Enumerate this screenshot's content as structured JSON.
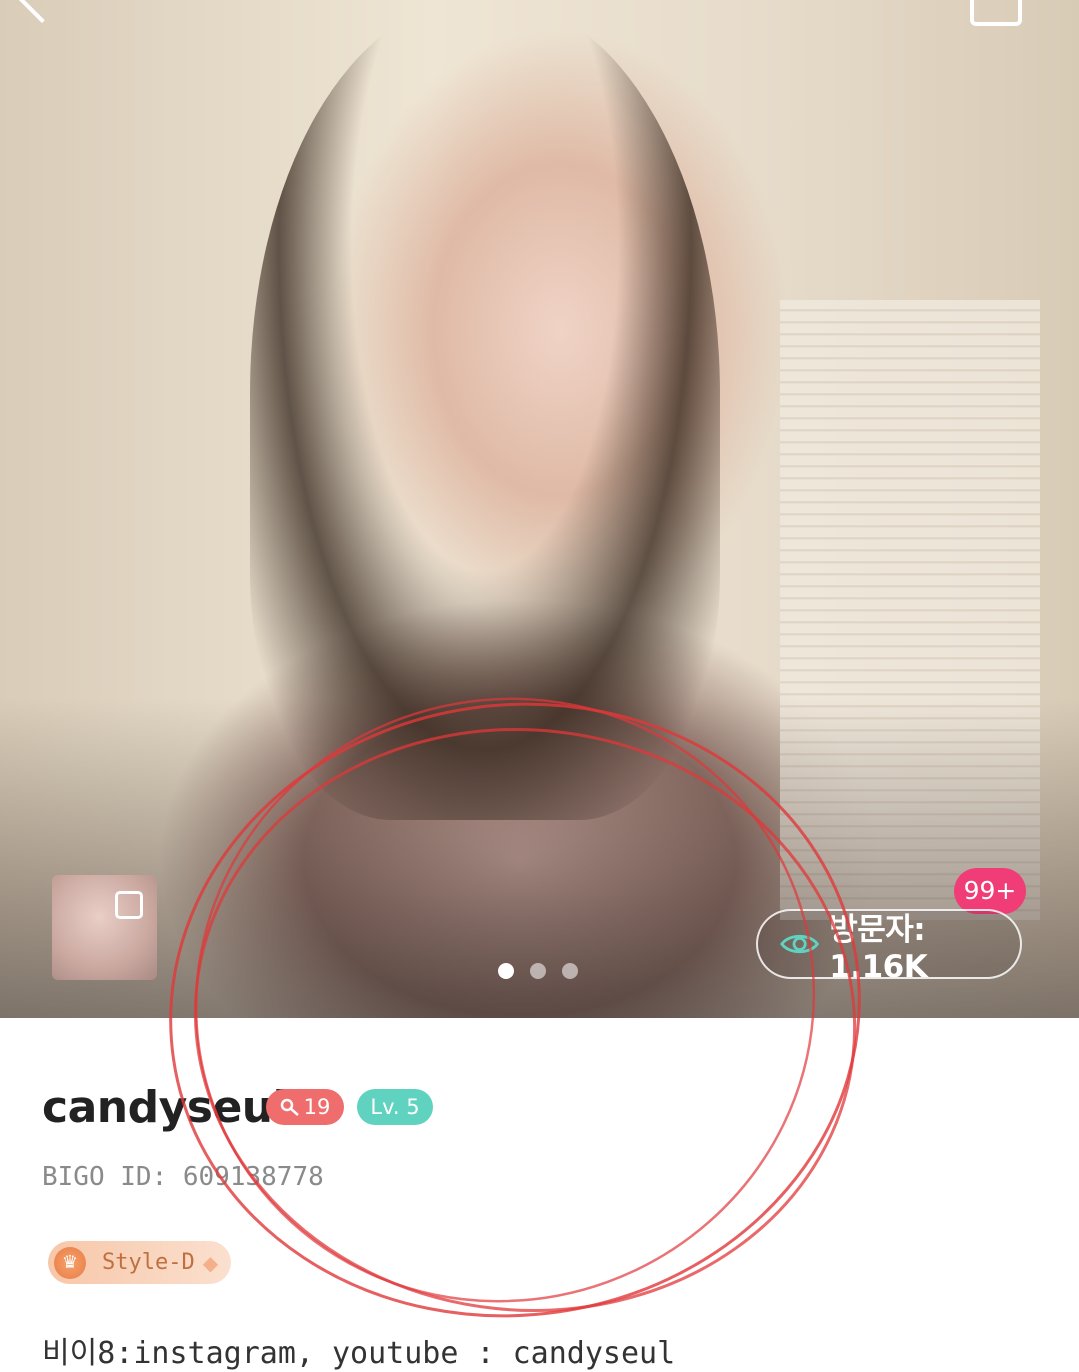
{
  "profile": {
    "username": "candyseul",
    "age_badge": "19",
    "level_badge": "Lv. 5",
    "bigo_id": "BIGO ID: 609138778",
    "style_badge": "Style-D",
    "bio": "비이8:instagram, youtube : candyseul"
  },
  "hero": {
    "visitors": "방문자: 1.16K",
    "notification_count": "99+",
    "carousel_pages": 3,
    "carousel_active_index": 0
  },
  "icons": {
    "back": "back-arrow-icon",
    "share": "share-icon",
    "visitor": "eye-icon",
    "age": "key-icon",
    "style": "crown-icon",
    "gem": "diamond-icon"
  },
  "colors": {
    "badge_pink": "#f03c77",
    "age_red": "#f06d6d",
    "level_teal": "#5fd3bf",
    "style_orange": "#e87c47",
    "annotation_red": "#e0383a"
  }
}
